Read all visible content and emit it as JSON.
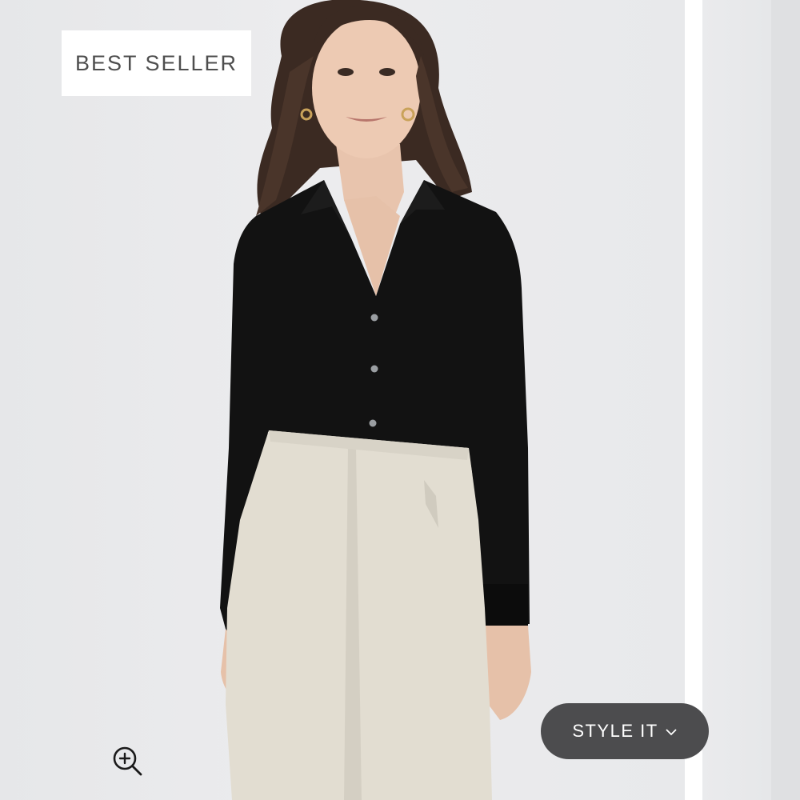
{
  "badge": {
    "label": "BEST SELLER"
  },
  "style_button": {
    "label": "STYLE IT",
    "icon": "chevron-down-icon"
  },
  "zoom": {
    "icon": "zoom-in-icon"
  },
  "product_image": {
    "subject": "model-wearing-black-blouse-and-ivory-trousers"
  },
  "colors": {
    "badge_background": "#ffffff",
    "badge_text": "#4e4e4e",
    "button_background": "#4c4c4e",
    "button_text": "#ffffff",
    "blouse": "#121212",
    "trousers": "#e2ddd1",
    "background": "#e9eaec"
  }
}
